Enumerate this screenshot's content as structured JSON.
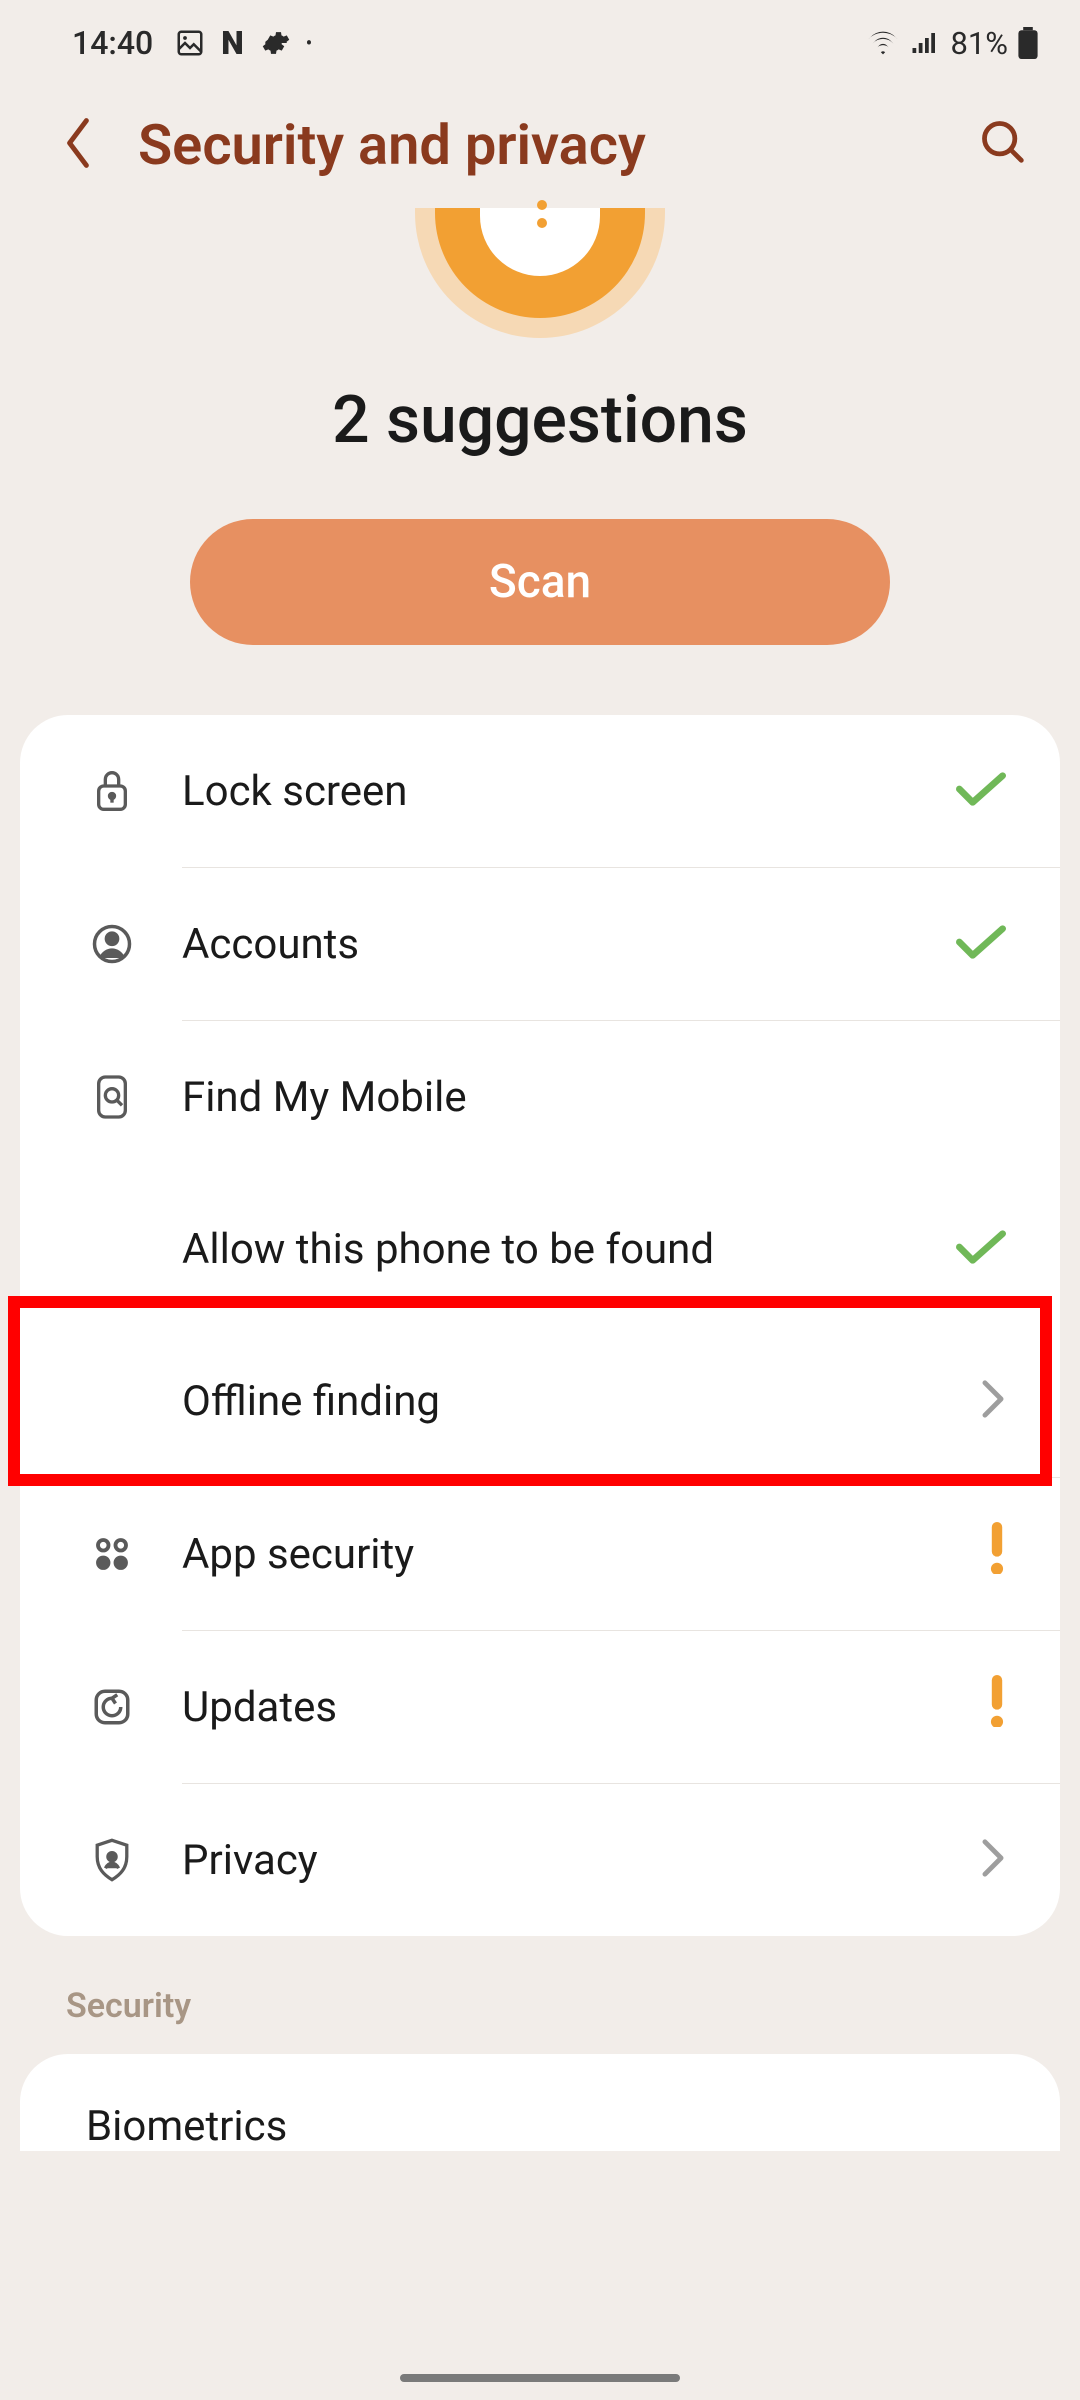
{
  "status": {
    "time": "14:40",
    "battery": "81%"
  },
  "header": {
    "title": "Security and privacy"
  },
  "suggestion": {
    "title": "2 suggestions",
    "scan_label": "Scan"
  },
  "items": {
    "lock_screen": {
      "label": "Lock screen",
      "status": "check"
    },
    "accounts": {
      "label": "Accounts",
      "status": "check"
    },
    "find_my_mobile": {
      "label": "Find My Mobile",
      "status": "none"
    },
    "allow_found": {
      "label": "Allow this phone to be found",
      "status": "check"
    },
    "offline_finding": {
      "label": "Offline finding",
      "status": "chevron"
    },
    "app_security": {
      "label": "App security",
      "status": "alert"
    },
    "updates": {
      "label": "Updates",
      "status": "alert"
    },
    "privacy": {
      "label": "Privacy",
      "status": "chevron"
    }
  },
  "section": {
    "security_label": "Security",
    "biometrics_label": "Biometrics"
  }
}
